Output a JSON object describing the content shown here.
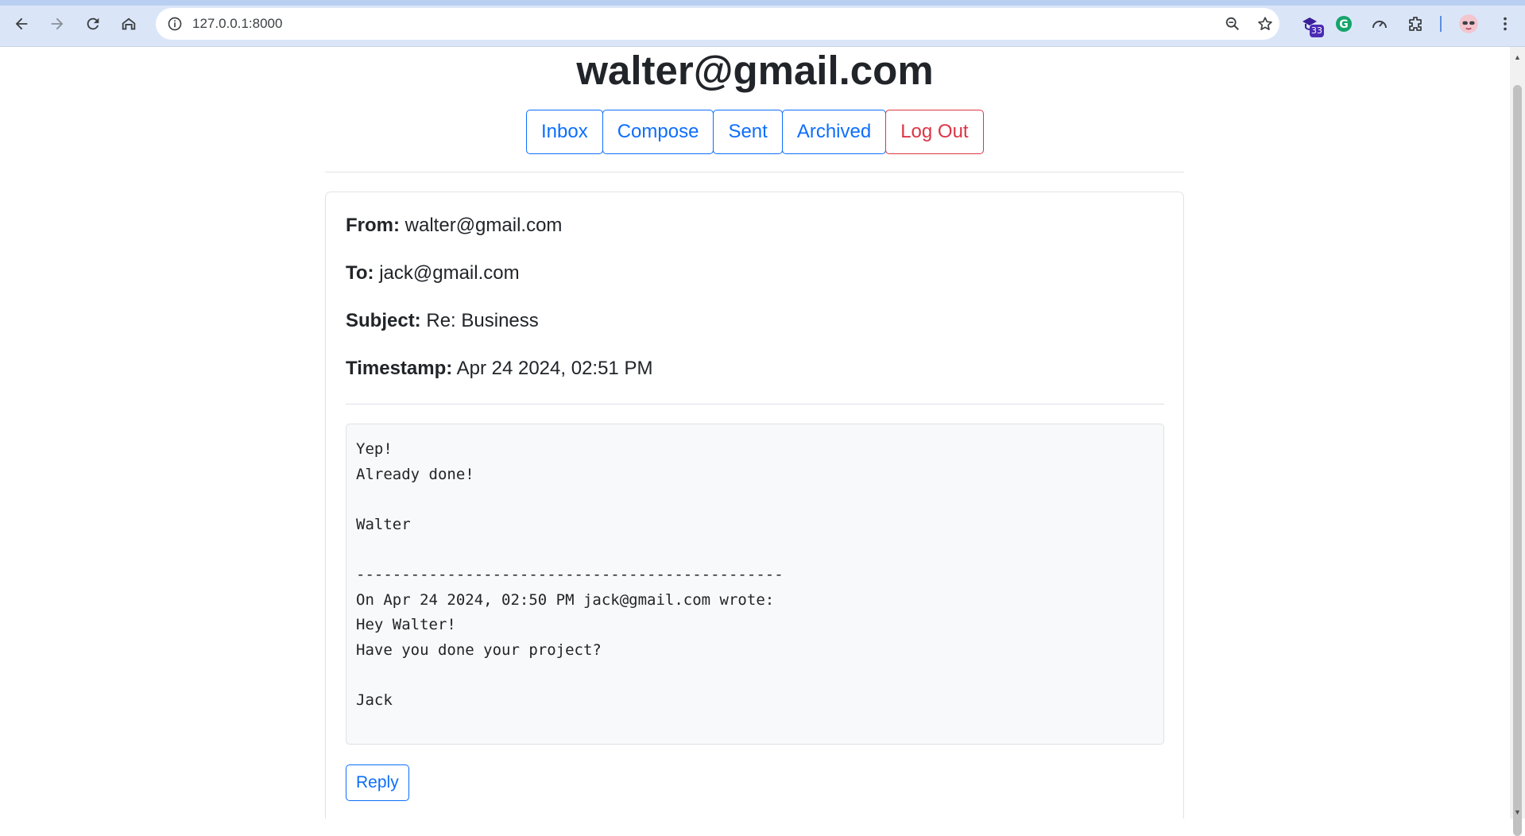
{
  "browser": {
    "url": "127.0.0.1:8000",
    "extension_badge": "33",
    "icons": [
      "back-arrow-icon",
      "forward-arrow-icon",
      "reload-icon",
      "home-icon",
      "info-icon",
      "zoom-icon",
      "star-icon",
      "extension-icon",
      "grammarly-icon",
      "performance-icon",
      "puzzle-icon",
      "profile-avatar-icon",
      "kebab-menu-icon"
    ]
  },
  "header": {
    "title": "walter@gmail.com"
  },
  "nav": {
    "inbox": "Inbox",
    "compose": "Compose",
    "sent": "Sent",
    "archived": "Archived",
    "logout": "Log Out"
  },
  "email": {
    "from_label": "From:",
    "from_value": "walter@gmail.com",
    "to_label": "To:",
    "to_value": "jack@gmail.com",
    "subject_label": "Subject:",
    "subject_value": "Re: Business",
    "timestamp_label": "Timestamp:",
    "timestamp_value": "Apr 24 2024, 02:51 PM",
    "body": "Yep!\nAlready done!\n\nWalter\n\n-----------------------------------------------\nOn Apr 24 2024, 02:50 PM jack@gmail.com wrote:\nHey Walter!\nHave you done your project?\n\nJack",
    "reply_label": "Reply"
  },
  "colors": {
    "primary": "#0d6efd",
    "danger": "#dc3545",
    "chrome": "#dae6f8"
  }
}
